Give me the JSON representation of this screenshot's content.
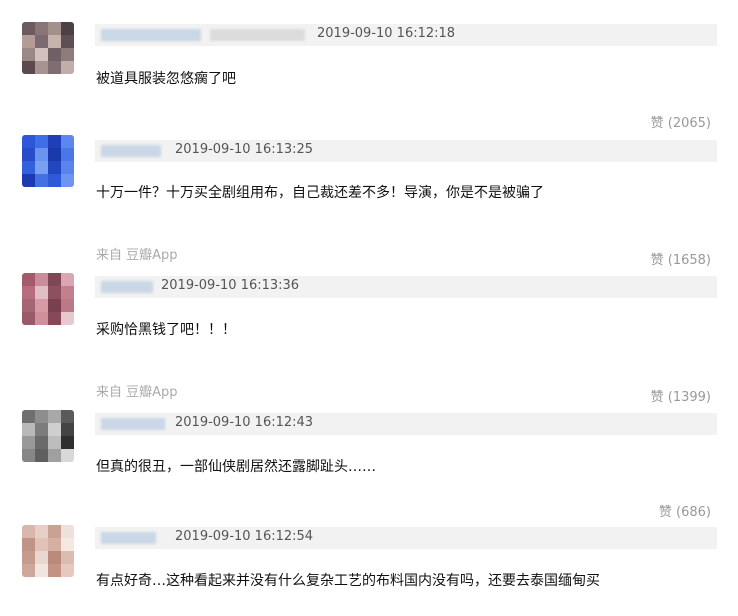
{
  "comments": [
    {
      "time": "2019-09-10 16:12:18",
      "text": "被道具服装忽悠瘸了吧",
      "source": "",
      "likes": "赞 (2065)"
    },
    {
      "time": "2019-09-10 16:13:25",
      "text": "十万一件？十万买全剧组用布，自己裁还差不多！导演，你是不是被骗了",
      "source": "来自 豆瓣App",
      "likes": "赞 (1658)"
    },
    {
      "time": "2019-09-10 16:13:36",
      "text": "采购恰黑钱了吧！！！",
      "source": "来自 豆瓣App",
      "likes": "赞 (1399)"
    },
    {
      "time": "2019-09-10 16:12:43",
      "text": "但真的很丑，一部仙侠剧居然还露脚趾头……",
      "source": "",
      "likes": "赞 (686)"
    },
    {
      "time": "2019-09-10 16:12:54",
      "text": "有点好奇…这种看起来并没有什么复杂工艺的布料国内没有吗，还要去泰国缅甸买",
      "source": "",
      "likes": ""
    }
  ],
  "avatar_palettes": [
    [
      "#6b5a5e",
      "#8a7478",
      "#a38f8c",
      "#4c3f45",
      "#b59b97",
      "#7b6b70",
      "#c7b3ad",
      "#5e4f55",
      "#9b8783",
      "#d2c2bd",
      "#6f6066",
      "#8e7c7d",
      "#5a4a50",
      "#a7938f",
      "#7f6d72",
      "#c1aea9"
    ],
    [
      "#2d56d8",
      "#3f6fe6",
      "#1e3fb8",
      "#5d86ee",
      "#284bc9",
      "#6b93f0",
      "#1a39a8",
      "#4a76e8",
      "#3360dc",
      "#7aa0f3",
      "#2246be",
      "#5884ec",
      "#1c3ab2",
      "#4470e4",
      "#2f59d6",
      "#6c94f0"
    ],
    [
      "#a35a6b",
      "#c98d9a",
      "#7d4756",
      "#d9a6b1",
      "#b66c7c",
      "#e1bdc5",
      "#8e4f5f",
      "#c37f8d",
      "#a56575",
      "#d69aa7",
      "#7a4050",
      "#bd7888",
      "#9a5a69",
      "#cf8f9c",
      "#87495a",
      "#e6c8ce"
    ],
    [
      "#6f6f6f",
      "#8d8d8d",
      "#a8a8a8",
      "#5a5a5a",
      "#b9b9b9",
      "#7c7c7c",
      "#cfcfcf",
      "#444444",
      "#999999",
      "#6a6a6a",
      "#bdbdbd",
      "#2f2f2f",
      "#868686",
      "#5f5f5f",
      "#a0a0a0",
      "#d8d8d8"
    ],
    [
      "#d8b8ad",
      "#e6cfc6",
      "#c9a295",
      "#f0e0da",
      "#bf9486",
      "#e0c2b7",
      "#d4afa2",
      "#f4e8e3",
      "#c59b8d",
      "#ead7cf",
      "#b98a7b",
      "#dcbcb0",
      "#cda799",
      "#f2e5df",
      "#c29485",
      "#e4c9bf"
    ]
  ],
  "accent_colors": {
    "meta_bar": "#f2f2f2",
    "source_text": "#aaaaaa",
    "like_text": "#999999"
  }
}
